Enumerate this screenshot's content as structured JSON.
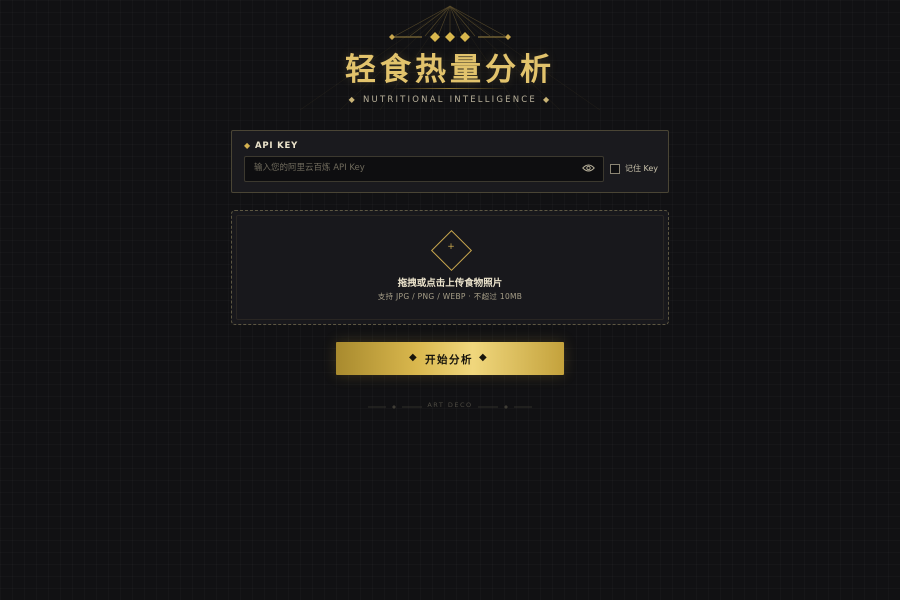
{
  "header": {
    "title": "轻食热量分析",
    "subtitle": "NUTRITIONAL INTELLIGENCE"
  },
  "api": {
    "label": "API KEY",
    "placeholder": "输入您的阿里云百炼 API Key",
    "value": "",
    "remember_label": "记住 Key"
  },
  "upload": {
    "plus": "+",
    "title": "拖拽或点击上传食物照片",
    "hint": "支持 JPG / PNG / WEBP · 不超过 10MB"
  },
  "action": {
    "label": "开始分析"
  },
  "footer": {
    "text": "ART DECO"
  },
  "colors": {
    "background": "#111113",
    "gold": "#e2c36c",
    "gold_dark": "#a88a2e",
    "card": "#1a1a1e"
  },
  "icons": {
    "header_ornament": "diamond-ornament-icon",
    "eye": "eye-icon",
    "upload": "diamond-plus-icon"
  }
}
